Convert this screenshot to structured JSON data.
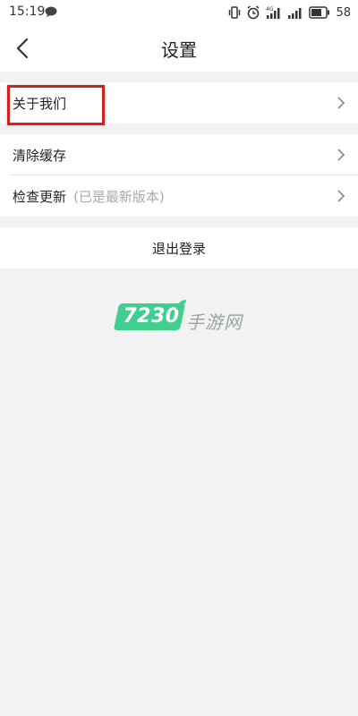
{
  "status_bar": {
    "time": "15:19",
    "signal_label": "4G",
    "battery": "58"
  },
  "nav": {
    "title": "设置"
  },
  "settings": {
    "about": "关于我们",
    "clear_cache": "清除缓存",
    "check_update": "检查更新",
    "check_update_sub": "(已是最新版本)",
    "logout": "退出登录"
  },
  "watermark": {
    "number": "7230",
    "text": "手游网"
  },
  "colors": {
    "highlight": "#d6201d",
    "brand_green": "#3fcf8f",
    "background": "#f2f2f2"
  }
}
